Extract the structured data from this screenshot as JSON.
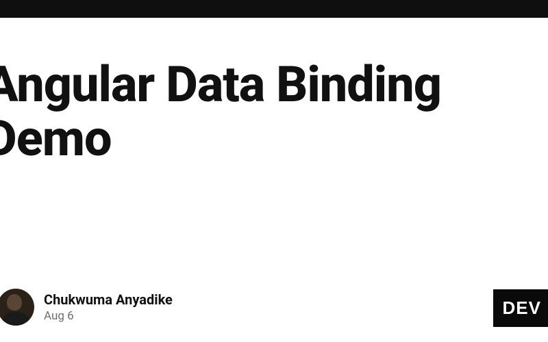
{
  "post": {
    "title": "Angular Data Binding Demo",
    "author_name": "Chukwuma Anyadike",
    "date": "Aug 6"
  },
  "badge": {
    "label": "DEV"
  }
}
